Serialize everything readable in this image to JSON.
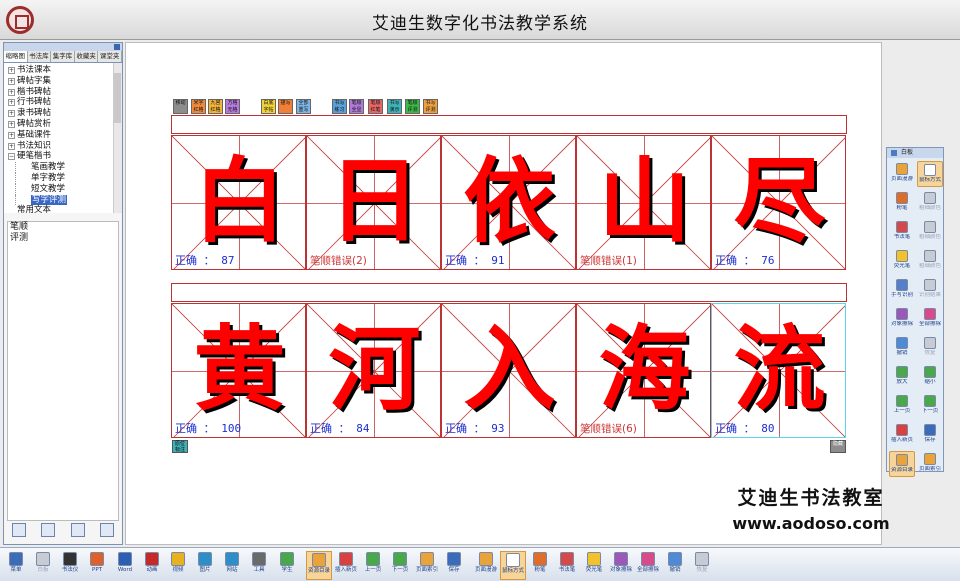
{
  "app": {
    "title": "艾迪生数字化书法教学系统"
  },
  "left_panel": {
    "tabs": [
      "缩略图",
      "书法库",
      "集字库",
      "收藏夹",
      "课堂夹"
    ],
    "tree": [
      {
        "label": "书法课本",
        "toggle": "+",
        "child": false,
        "selected": false
      },
      {
        "label": "碑帖字集",
        "toggle": "+",
        "child": false,
        "selected": false
      },
      {
        "label": "楷书碑帖",
        "toggle": "+",
        "child": false,
        "selected": false
      },
      {
        "label": "行书碑帖",
        "toggle": "+",
        "child": false,
        "selected": false
      },
      {
        "label": "隶书碑帖",
        "toggle": "+",
        "child": false,
        "selected": false
      },
      {
        "label": "碑帖赏析",
        "toggle": "+",
        "child": false,
        "selected": false
      },
      {
        "label": "基础课件",
        "toggle": "+",
        "child": false,
        "selected": false
      },
      {
        "label": "书法知识",
        "toggle": "+",
        "child": false,
        "selected": false
      },
      {
        "label": "硬笔楷书",
        "toggle": "−",
        "child": false,
        "selected": false
      },
      {
        "label": "笔画教学",
        "toggle": "",
        "child": true,
        "selected": false
      },
      {
        "label": "单字教学",
        "toggle": "",
        "child": true,
        "selected": false
      },
      {
        "label": "短文教学",
        "toggle": "",
        "child": true,
        "selected": false
      },
      {
        "label": "写字评测",
        "toggle": "",
        "child": true,
        "selected": true
      },
      {
        "label": "常用文本",
        "toggle": "",
        "child": false,
        "selected": false
      }
    ],
    "text_lines": [
      "笔顺",
      "评测"
    ]
  },
  "mini_toolbar": [
    {
      "label": "移动",
      "color": "#8d8d8d"
    },
    {
      "label": "米字 红格",
      "color": "#f08a3c"
    },
    {
      "label": "九宫 红格",
      "color": "#f0b43c"
    },
    {
      "label": "方格 无格",
      "color": "#b77adf"
    },
    {
      "label": "白底 字帖",
      "color": "#f3d23a"
    },
    {
      "label": "描写",
      "color": "#f07f3a"
    },
    {
      "label": "全部 重写",
      "color": "#7fb6e8"
    },
    {
      "label": "书写 练习",
      "color": "#5aa0d8"
    },
    {
      "label": "笔顺 全显",
      "color": "#b07ad8"
    },
    {
      "label": "笔顺 红笔",
      "color": "#e86868"
    },
    {
      "label": "书写 演示",
      "color": "#3fb2b8"
    },
    {
      "label": "笔顺 评测",
      "color": "#3dbb4a"
    },
    {
      "label": "书写 评测",
      "color": "#f0a040"
    }
  ],
  "rows": [
    {
      "cells": [
        {
          "char": "白",
          "result": "正确 ： 87",
          "error": false,
          "active": false
        },
        {
          "char": "日",
          "result": "笔顺错误(2)",
          "error": true,
          "active": false
        },
        {
          "char": "依",
          "result": "正确 ： 91",
          "error": false,
          "active": false
        },
        {
          "char": "山",
          "result": "笔顺错误(1)",
          "error": true,
          "active": false
        },
        {
          "char": "尽",
          "result": "正确 ： 76",
          "error": false,
          "active": false
        }
      ]
    },
    {
      "cells": [
        {
          "char": "黄",
          "result": "正确 ： 100",
          "error": false,
          "active": false
        },
        {
          "char": "河",
          "result": "正确 ： 84",
          "error": false,
          "active": false
        },
        {
          "char": "入",
          "result": "正确 ： 93",
          "error": false,
          "active": false
        },
        {
          "char": "海",
          "result": "笔顺错误(6)",
          "error": true,
          "active": false
        },
        {
          "char": "流",
          "result": "正确 ： 80",
          "error": false,
          "active": true
        }
      ]
    }
  ],
  "canvas_buttons": {
    "left": "原位 标注",
    "right": "隐藏"
  },
  "brand": {
    "name": "艾迪生书法教室",
    "url": "www.aodoso.com"
  },
  "palette": {
    "title": "白板",
    "buttons": [
      {
        "label": "页面漫游",
        "color": "#e8a33a",
        "on": false,
        "dim": false
      },
      {
        "label": "鼠标方式",
        "color": "#ffffff",
        "on": true,
        "dim": false
      },
      {
        "label": "粉笔",
        "color": "#e06c2a",
        "on": false,
        "dim": false
      },
      {
        "label": "粗细颜色",
        "color": "#c7ccd4",
        "on": false,
        "dim": true
      },
      {
        "label": "书法笔",
        "color": "#d24a4a",
        "on": false,
        "dim": false
      },
      {
        "label": "粗细颜色",
        "color": "#c7ccd4",
        "on": false,
        "dim": true
      },
      {
        "label": "荧光笔",
        "color": "#f1c22c",
        "on": false,
        "dim": false
      },
      {
        "label": "粗细颜色",
        "color": "#c7ccd4",
        "on": false,
        "dim": true
      },
      {
        "label": "手写识别",
        "color": "#5580c8",
        "on": false,
        "dim": false
      },
      {
        "label": "识别结果",
        "color": "#c7ccd4",
        "on": false,
        "dim": true
      },
      {
        "label": "对象擦除",
        "color": "#9b58b8",
        "on": false,
        "dim": false
      },
      {
        "label": "全部擦除",
        "color": "#d84a8a",
        "on": false,
        "dim": false
      },
      {
        "label": "撤销",
        "color": "#4e8ad6",
        "on": false,
        "dim": false
      },
      {
        "label": "恢复",
        "color": "#c7ccd4",
        "on": false,
        "dim": true
      },
      {
        "label": "放大",
        "color": "#49a84a",
        "on": false,
        "dim": false
      },
      {
        "label": "缩小",
        "color": "#49a84a",
        "on": false,
        "dim": false
      },
      {
        "label": "上一页",
        "color": "#49a84a",
        "on": false,
        "dim": false
      },
      {
        "label": "下一页",
        "color": "#49a84a",
        "on": false,
        "dim": false
      },
      {
        "label": "插入新页",
        "color": "#d94040",
        "on": false,
        "dim": false
      },
      {
        "label": "保存",
        "color": "#3b6cb8",
        "on": false,
        "dim": false
      },
      {
        "label": "资源目录",
        "color": "#e8a33a",
        "on": true,
        "dim": false
      },
      {
        "label": "页面索引",
        "color": "#e8a33a",
        "on": false,
        "dim": false
      }
    ]
  },
  "bottom_toolbar": [
    {
      "label": "菜单",
      "color": "#3b6cb8",
      "on": false,
      "dim": false
    },
    {
      "label": "白板",
      "color": "#c7ccd4",
      "on": false,
      "dim": true
    },
    {
      "label": "书法仪",
      "color": "#333333",
      "on": false,
      "dim": false
    },
    {
      "label": "PPT",
      "color": "#e0602a",
      "on": false,
      "dim": false
    },
    {
      "label": "Word",
      "color": "#2b5fb4",
      "on": false,
      "dim": false
    },
    {
      "label": "动画",
      "color": "#c42a2a",
      "on": false,
      "dim": false
    },
    {
      "label": "视频",
      "color": "#e8b21f",
      "on": false,
      "dim": false
    },
    {
      "label": "图片",
      "color": "#2c8fc8",
      "on": false,
      "dim": false
    },
    {
      "label": "网站",
      "color": "#2c8fc8",
      "on": false,
      "dim": false
    },
    {
      "label": "工具",
      "color": "#6a6a6a",
      "on": false,
      "dim": false
    },
    {
      "label": "学生",
      "color": "#49a84a",
      "on": false,
      "dim": false
    },
    {
      "label": "资源目录",
      "color": "#e8a33a",
      "on": true,
      "dim": false
    },
    {
      "label": "插入新页",
      "color": "#d94040",
      "on": false,
      "dim": false
    },
    {
      "label": "上一页",
      "color": "#49a84a",
      "on": false,
      "dim": false
    },
    {
      "label": "下一页",
      "color": "#49a84a",
      "on": false,
      "dim": false
    },
    {
      "label": "页面索引",
      "color": "#e8a33a",
      "on": false,
      "dim": false
    },
    {
      "label": "保存",
      "color": "#3b6cb8",
      "on": false,
      "dim": false
    },
    {
      "label": "页面漫游",
      "color": "#e8a33a",
      "on": false,
      "dim": false
    },
    {
      "label": "鼠标方式",
      "color": "#ffffff",
      "on": true,
      "dim": false
    },
    {
      "label": "粉笔",
      "color": "#e06c2a",
      "on": false,
      "dim": false
    },
    {
      "label": "书法笔",
      "color": "#d24a4a",
      "on": false,
      "dim": false
    },
    {
      "label": "荧光笔",
      "color": "#f1c22c",
      "on": false,
      "dim": false
    },
    {
      "label": "对象擦除",
      "color": "#9b58b8",
      "on": false,
      "dim": false
    },
    {
      "label": "全部擦除",
      "color": "#d84a8a",
      "on": false,
      "dim": false
    },
    {
      "label": "撤销",
      "color": "#4e8ad6",
      "on": false,
      "dim": false
    },
    {
      "label": "恢复",
      "color": "#c7ccd4",
      "on": false,
      "dim": true
    }
  ]
}
